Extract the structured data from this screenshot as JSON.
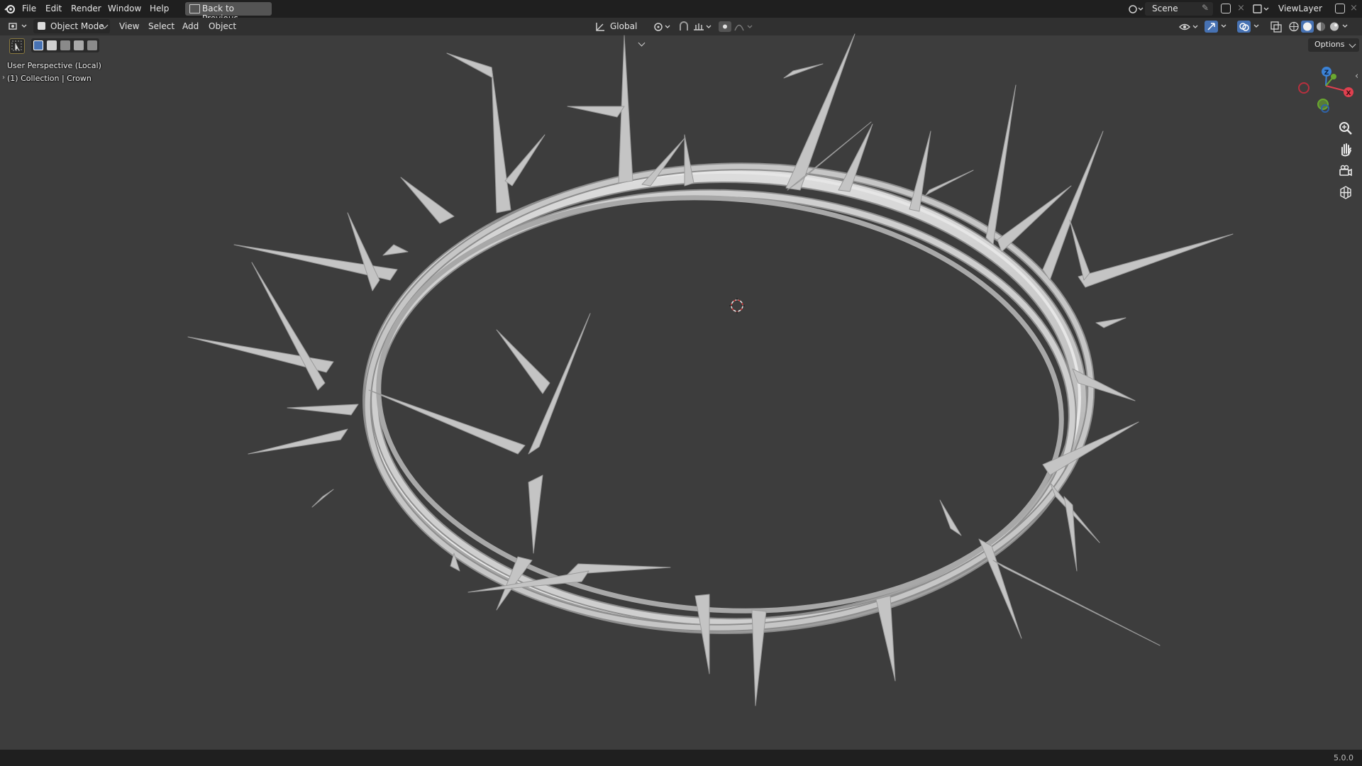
{
  "app": {
    "name": "Blender",
    "version": "5.0.0"
  },
  "topbar": {
    "menus": [
      "File",
      "Edit",
      "Render",
      "Window",
      "Help"
    ],
    "back_button": "Back to Previous",
    "scene": "Scene",
    "view_layer": "ViewLayer"
  },
  "header": {
    "mode": "Object Mode",
    "menus": [
      "View",
      "Select",
      "Add",
      "Object"
    ],
    "transform_orientation": "Global",
    "options_label": "Options"
  },
  "viewport": {
    "view_name": "User Perspective (Local)",
    "collection_info": "(1) Collection | Crown",
    "object": "Crown",
    "shading": "solid",
    "gizmo_axes": {
      "z": "Z",
      "x": "X"
    },
    "colors": {
      "background": "#3d3d3d",
      "mesh": "#c8c8c8",
      "x_axis": "#e0404f",
      "y_axis": "#6aa830",
      "z_axis": "#3b82d6"
    }
  },
  "icons": {
    "nav": [
      "zoom-icon",
      "pan-hand-icon",
      "camera-icon",
      "ortho-grid-icon"
    ]
  }
}
